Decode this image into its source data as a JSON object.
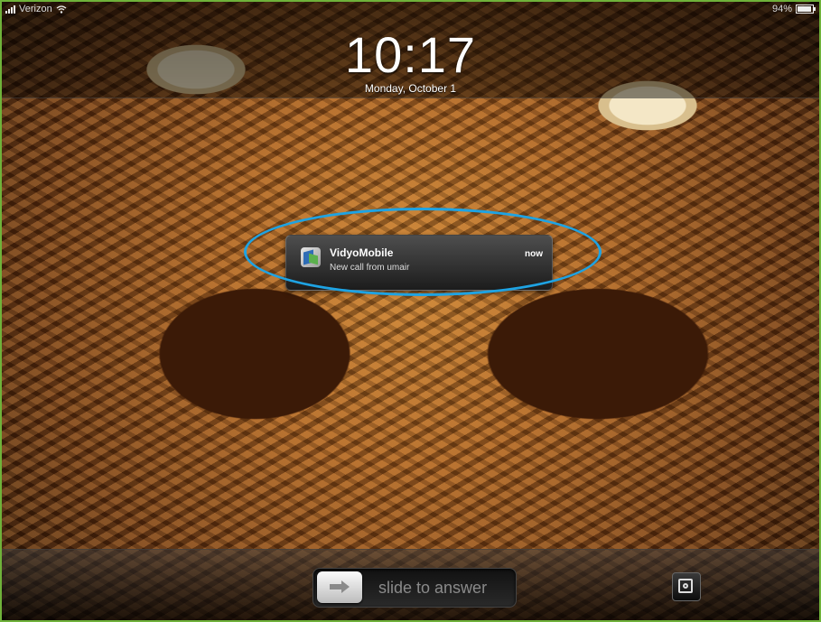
{
  "status_bar": {
    "carrier": "Verizon",
    "battery": "94%"
  },
  "lock_screen": {
    "time": "10:17",
    "date": "Monday, October 1"
  },
  "notification": {
    "app_name": "VidyoMobile",
    "message": "New call from umair",
    "time": "now"
  },
  "slider": {
    "label": "slide to answer"
  },
  "colors": {
    "highlight": "#1ea3e3",
    "frame_border": "#6fb23a"
  },
  "icons": {
    "status": [
      "signal-icon",
      "wifi-icon",
      "battery-icon"
    ],
    "app": "vidyomobile-app-icon",
    "slider": "arrow-right-icon",
    "camera": "camera-icon"
  }
}
